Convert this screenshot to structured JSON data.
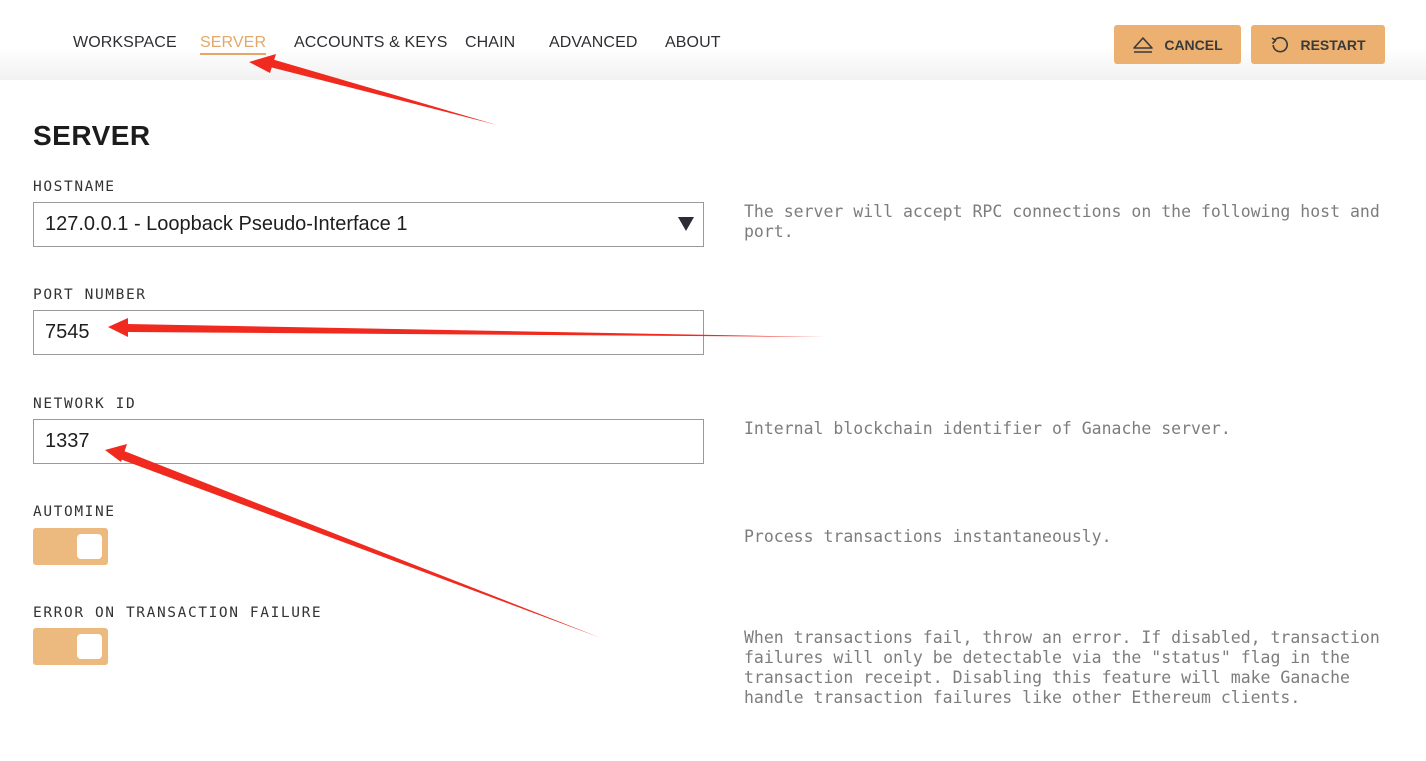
{
  "nav": {
    "tabs": [
      {
        "label": "WORKSPACE"
      },
      {
        "label": "SERVER"
      },
      {
        "label": "ACCOUNTS & KEYS"
      },
      {
        "label": "CHAIN"
      },
      {
        "label": "ADVANCED"
      },
      {
        "label": "ABOUT"
      }
    ],
    "active_tab": "SERVER"
  },
  "actions": {
    "cancel_label": "CANCEL",
    "cancel_icon": "eject-icon",
    "restart_label": "RESTART",
    "restart_icon": "restart-icon"
  },
  "page": {
    "title": "SERVER"
  },
  "settings": {
    "hostname": {
      "label": "HOSTNAME",
      "value": "127.0.0.1 - Loopback Pseudo-Interface 1",
      "description": "The server will accept RPC connections on the following host and port."
    },
    "port": {
      "label": "PORT NUMBER",
      "value": "7545"
    },
    "network_id": {
      "label": "NETWORK ID",
      "value": "1337",
      "description": "Internal blockchain identifier of Ganache server."
    },
    "automine": {
      "label": "AUTOMINE",
      "enabled": true,
      "description": "Process transactions instantaneously."
    },
    "error_on_failure": {
      "label": "ERROR ON TRANSACTION FAILURE",
      "enabled": true,
      "description": "When transactions fail, throw an error. If disabled, transaction failures will only be detectable via the \"status\" flag in the transaction receipt. Disabling this feature will make Ganache handle transaction failures like other Ethereum clients."
    }
  },
  "colors": {
    "accent": "#ecb071",
    "active_tab": "#e3a869",
    "annotation_arrow": "#f02a1e"
  }
}
